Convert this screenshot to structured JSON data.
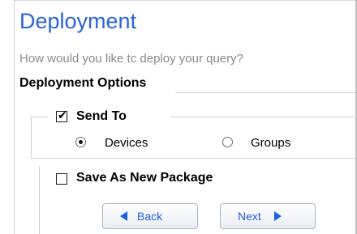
{
  "title": "Deployment",
  "subtitle": "How would you like tc deploy your query?",
  "section_header": "Deployment Options",
  "send_to": {
    "label": "Send To",
    "checked": true,
    "options": [
      {
        "label": "Devices",
        "selected": true
      },
      {
        "label": "Groups",
        "selected": false
      }
    ]
  },
  "save_package": {
    "label": "Save As New Package",
    "checked": false
  },
  "buttons": {
    "back": "Back",
    "next": "Next"
  },
  "colors": {
    "title": "#2b63d8",
    "accent": "#1f5fe0",
    "subtitle": "#8a8a8a"
  }
}
